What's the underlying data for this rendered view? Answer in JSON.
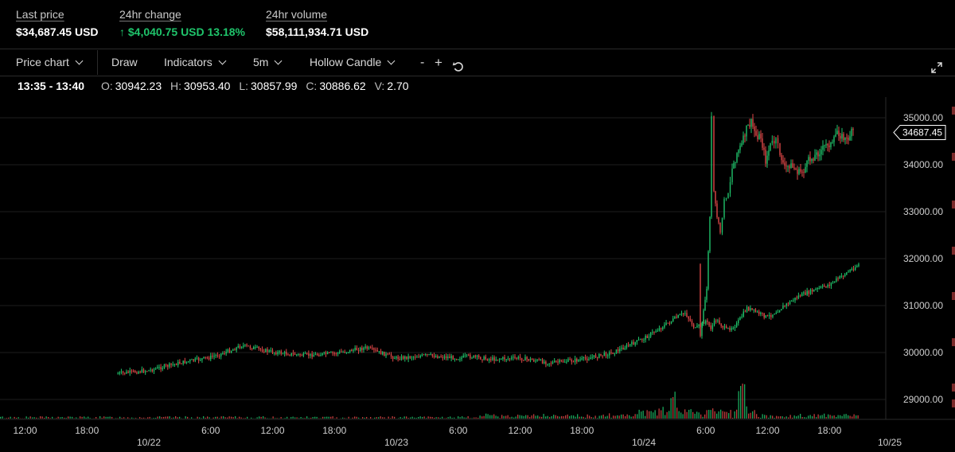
{
  "stats": {
    "last_price": {
      "label": "Last price",
      "value": "$34,687.45 USD"
    },
    "change_24h": {
      "label": "24hr change",
      "value": "$4,040.75 USD 13.18%",
      "direction": "up"
    },
    "volume_24h": {
      "label": "24hr volume",
      "value": "$58,111,934.71 USD"
    }
  },
  "toolbar": {
    "price_chart": "Price chart",
    "draw": "Draw",
    "indicators": "Indicators",
    "interval": "5m",
    "candle_style": "Hollow Candle",
    "zoom_out": "-",
    "zoom_in": "+",
    "reset_icon": "reset-icon",
    "fullscreen_icon": "expand-icon"
  },
  "ohlc": {
    "range": "13:35 - 13:40",
    "o_label": "O:",
    "o": "30942.23",
    "h_label": "H:",
    "h": "30953.40",
    "l_label": "L:",
    "l": "30857.99",
    "c_label": "C:",
    "c": "30886.62",
    "v_label": "V:",
    "v": "2.70"
  },
  "colors": {
    "up": "#1fc46b",
    "down": "#e04848",
    "grid": "#1e1e1e",
    "axis_text": "#cfcfcf"
  },
  "chart_data": {
    "type": "line",
    "title": "",
    "xlabel": "",
    "ylabel": "",
    "y_ticks": [
      "35000.00",
      "34000.00",
      "33000.00",
      "32000.00",
      "31000.00",
      "30000.00",
      "29000.00"
    ],
    "x_ticks": [
      "12:00",
      "18:00",
      "6:00",
      "12:00",
      "18:00",
      "6:00",
      "12:00",
      "18:00",
      "6:00",
      "12:00",
      "18:00"
    ],
    "date_labels": [
      "10/22",
      "10/23",
      "10/24",
      "10/25"
    ],
    "last_price_tag": "34687.45",
    "ylim": [
      28600,
      35000
    ],
    "grid": true,
    "series": [
      {
        "x": [
          "10/21 21:00",
          "10/22 00:00",
          "10/22 03:00",
          "10/22 06:00",
          "10/22 08:00",
          "10/22 09:00",
          "10/22 12:00",
          "10/22 15:00",
          "10/22 18:00",
          "10/22 21:00",
          "10/23 00:00",
          "10/23 03:00",
          "10/23 06:00",
          "10/23 07:00",
          "10/23 09:00",
          "10/23 12:00",
          "10/23 15:00",
          "10/23 18:00",
          "10/23 21:00",
          "10/24 00:00",
          "10/24 03:00",
          "10/24 04:00",
          "10/24 05:00",
          "10/24 06:00",
          "10/24 06:30",
          "10/24 07:00",
          "10/24 08:00",
          "10/24 09:00",
          "10/24 10:00",
          "10/24 12:00",
          "10/24 13:00",
          "10/24 15:00",
          "10/24 18:00",
          "10/24 21:00"
        ],
        "values": [
          29550,
          29620,
          29780,
          29900,
          30050,
          30150,
          30010,
          29940,
          29980,
          30100,
          29880,
          29940,
          29880,
          29920,
          29860,
          29880,
          29780,
          29850,
          30000,
          30300,
          30720,
          30850,
          30500,
          30680,
          30520,
          30700,
          30480,
          30600,
          30950,
          30750,
          30900,
          31200,
          31450,
          31900
        ],
        "y_note": "price (USD)"
      }
    ]
  }
}
